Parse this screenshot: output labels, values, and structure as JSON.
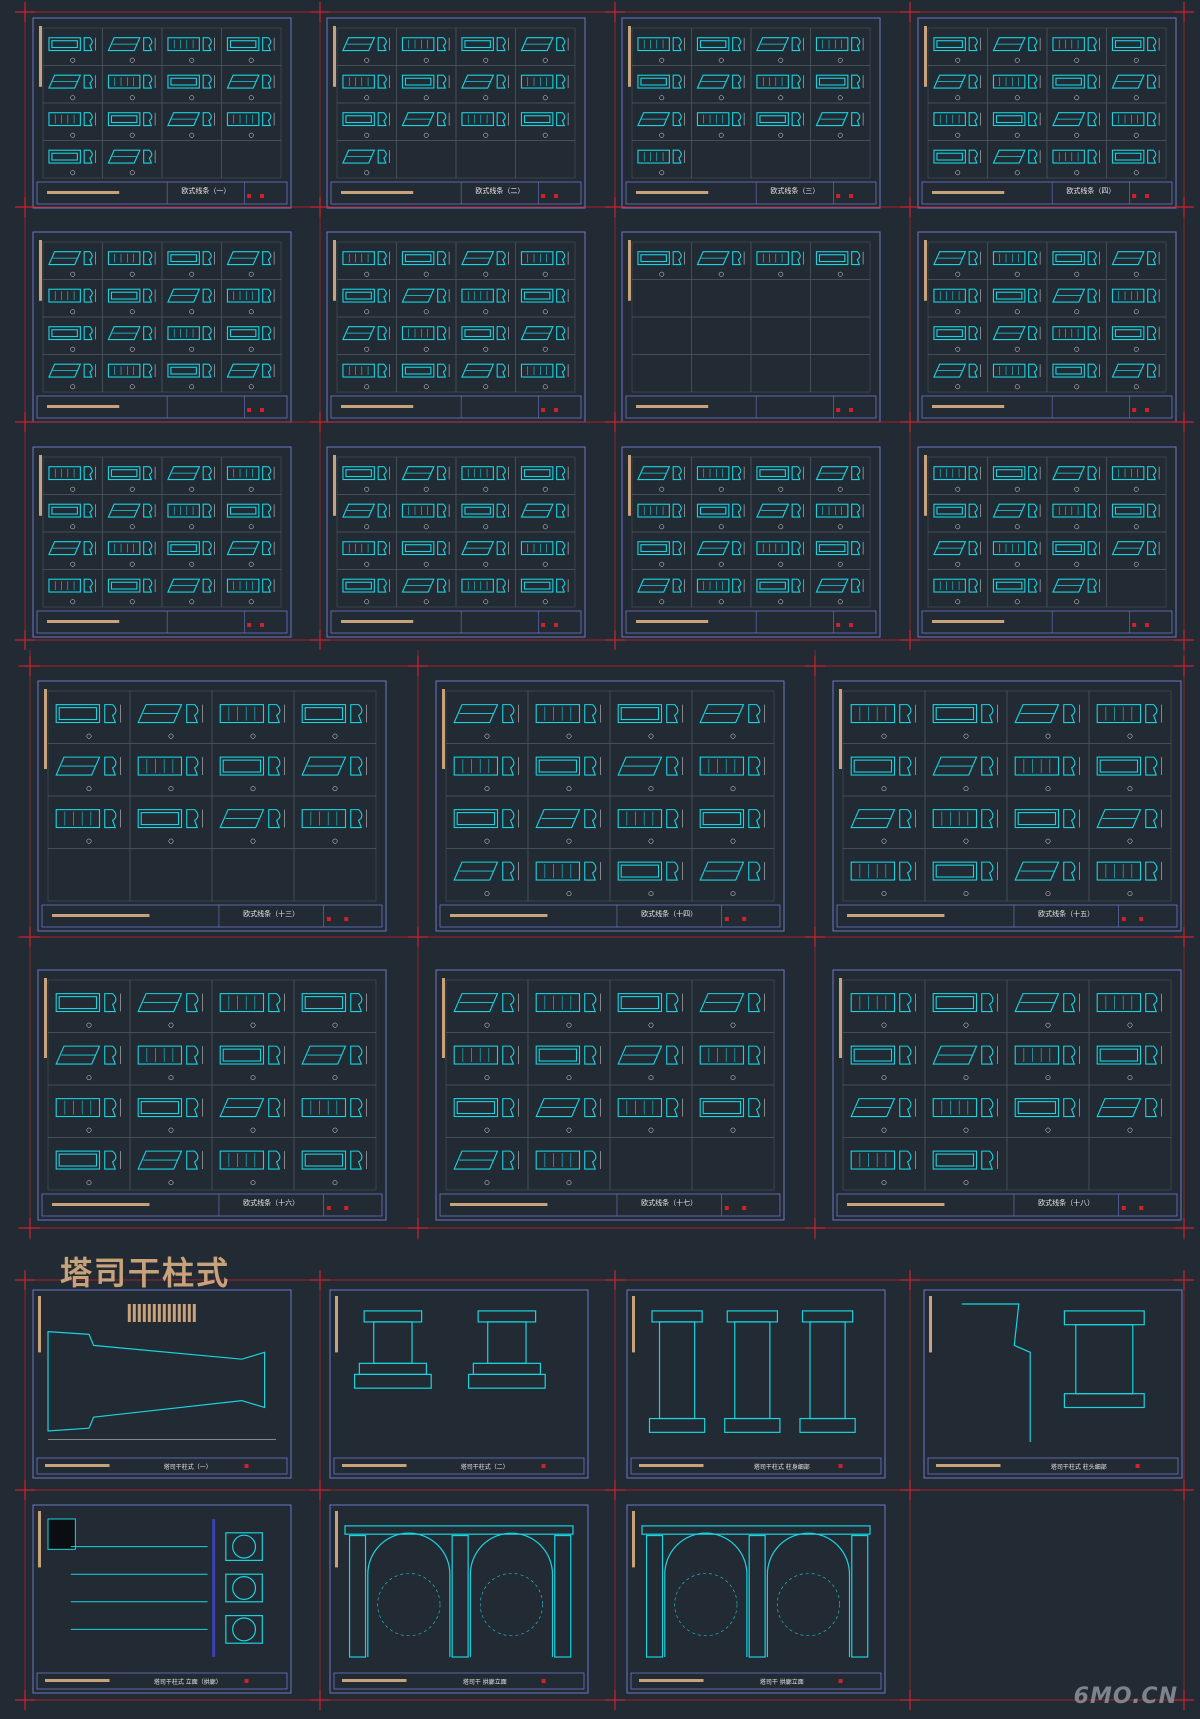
{
  "colors": {
    "background": "#222a33",
    "cad_line": "#19d3df",
    "frame": "#6f76c6",
    "grid": "#4c5660",
    "cut_mark": "#d0222a",
    "accent_bar": "#c8a27a",
    "label": "#e7e7e7"
  },
  "section": {
    "title": "塔司干柱式"
  },
  "sheets_row_titles": [
    "欧式线条（一）",
    "欧式线条（二）",
    "欧式线条（三）",
    "欧式线条（四）",
    "",
    "",
    "",
    "",
    "",
    "",
    "",
    "",
    "欧式线条（十三）",
    "欧式线条（十四）",
    "欧式线条（十五）",
    "欧式线条（十六）",
    "欧式线条（十七）",
    "欧式线条（十八）"
  ],
  "column_sheet_titles": [
    "塔司干柱式（一）",
    "塔司干柱式（二）",
    "塔司干柱式 柱身细部",
    "塔司干柱式 柱头细部",
    "塔司干柱式 立面（拱廊）",
    "塔司干 拱廊立面",
    "塔司干 拱廊立面"
  ],
  "watermark": "6MO.CN"
}
